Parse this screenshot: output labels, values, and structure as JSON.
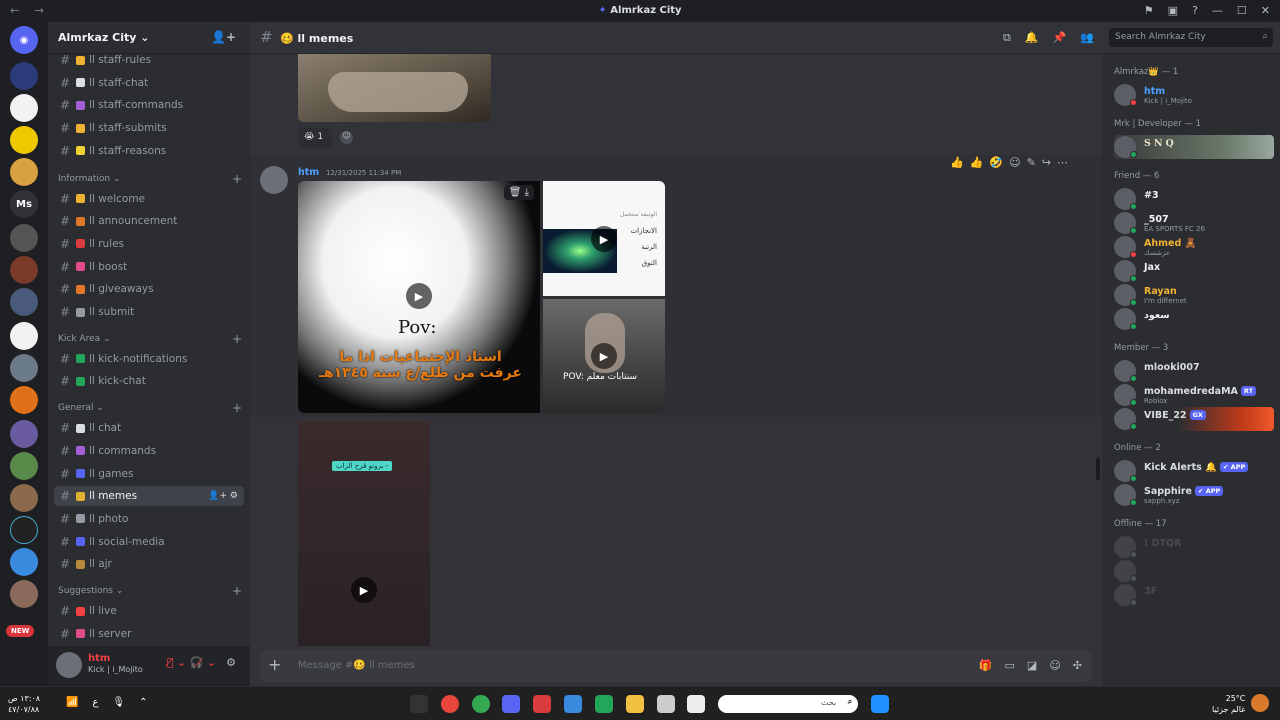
{
  "window": {
    "title": "Almrkaz City"
  },
  "server": {
    "name": "Almrkaz City"
  },
  "channels": {
    "top": [
      {
        "name": "staff-rules",
        "emoji_color": "#f0b232"
      },
      {
        "name": "staff-chat",
        "emoji_color": "#dbdee1"
      },
      {
        "name": "staff-commands",
        "emoji_color": "#a55fd6"
      },
      {
        "name": "staff-submits",
        "emoji_color": "#f0b232"
      },
      {
        "name": "staff-reasons",
        "emoji_color": "#f0d232"
      }
    ],
    "categories": [
      {
        "name": "Information",
        "items": [
          {
            "name": "welcome",
            "emoji_color": "#f0b232"
          },
          {
            "name": "announcement",
            "emoji_color": "#e0772a"
          },
          {
            "name": "rules",
            "emoji_color": "#d83c3e"
          },
          {
            "name": "boost",
            "emoji_color": "#e04c8a"
          },
          {
            "name": "giveaways",
            "emoji_color": "#e0772a"
          },
          {
            "name": "submit",
            "emoji_color": "#949ba4"
          }
        ]
      },
      {
        "name": "Kick Area",
        "items": [
          {
            "name": "kick-notifications",
            "emoji_color": "#23a55a"
          },
          {
            "name": "kick-chat",
            "emoji_color": "#23a55a"
          }
        ]
      },
      {
        "name": "General",
        "items": [
          {
            "name": "chat",
            "emoji_color": "#dbdee1"
          },
          {
            "name": "commands",
            "emoji_color": "#a55fd6"
          },
          {
            "name": "games",
            "emoji_color": "#5865f2"
          },
          {
            "name": "memes",
            "emoji_color": "#e0b232"
          },
          {
            "name": "photo",
            "emoji_color": "#949ba4"
          },
          {
            "name": "social-media",
            "emoji_color": "#5865f2"
          },
          {
            "name": "ajr",
            "emoji_color": "#b58a3a"
          }
        ]
      },
      {
        "name": "Suggestions",
        "items": [
          {
            "name": "live",
            "emoji_color": "#f23f43"
          },
          {
            "name": "server",
            "emoji_color": "#e04c8a"
          }
        ]
      }
    ]
  },
  "active_channel": "memes",
  "user": {
    "name": "htm",
    "status": "Kick | i_Mojito"
  },
  "chat_header": {
    "channel": "ll memes"
  },
  "search": {
    "placeholder": "Search Almrkaz City"
  },
  "messages": {
    "reaction_count": "1",
    "author": "htm",
    "timestamp": "12/31/2025 11:34 PM",
    "media1": {
      "pov": "Pov:",
      "caption": "استاذ الإجتماعيات اذا ما عرفت من طلع/ع سنة ١٣٤٥هـ"
    },
    "media2": {
      "lines": [
        "الانجازات",
        "الرتبة",
        "التوق"
      ],
      "header": "الوثيقة ستحمل"
    },
    "media3": {
      "caption": "POV: سنتابات معلم"
    },
    "media4": {
      "tag": "برونو قرح الراب -"
    }
  },
  "composer": {
    "placeholder": "Message #🥴 ll memes"
  },
  "members": {
    "groups": [
      {
        "label": "Almrkaz👑 — 1",
        "members": [
          {
            "name": "htm",
            "sub": "Kick | i_Mojito",
            "color": "#4ea0ff",
            "status": "#f23f43"
          }
        ]
      },
      {
        "label": "Mrk | Developer — 1",
        "members": [
          {
            "name": "SNQ",
            "sub": "",
            "color": "#e8e0c8",
            "status": "#23a55a"
          }
        ]
      },
      {
        "label": "Friend — 6",
        "members": [
          {
            "name": "#3",
            "sub": "",
            "color": "#f2f3f5",
            "status": "#23a55a"
          },
          {
            "name": "_507",
            "sub": "EA SPORTS FC 26",
            "color": "#f2f3f5",
            "status": "#23a55a"
          },
          {
            "name": "Ahmed 🧸",
            "sub": "عزشسك",
            "color": "#f0b232",
            "status": "#f23f43"
          },
          {
            "name": "Jax",
            "sub": "",
            "color": "#f2f3f5",
            "status": "#23a55a"
          },
          {
            "name": "Rayan",
            "sub": "I'm differnet",
            "color": "#f0b232",
            "status": "#23a55a"
          },
          {
            "name": "سعود",
            "sub": "",
            "color": "#f2f3f5",
            "status": "#23a55a"
          }
        ]
      },
      {
        "label": "Member — 3",
        "members": [
          {
            "name": "mlooki007",
            "sub": "",
            "color": "#dbdee1",
            "status": "#23a55a"
          },
          {
            "name": "mohamedredaMA",
            "sub": "Roblox",
            "color": "#dbdee1",
            "status": "#23a55a",
            "badge": "RT"
          },
          {
            "name": "VIBE_22",
            "sub": "",
            "color": "#dbdee1",
            "status": "#23a55a",
            "badge": "GX"
          }
        ]
      },
      {
        "label": "Online — 2",
        "members": [
          {
            "name": "Kick Alerts 🔔",
            "sub": "",
            "color": "#dbdee1",
            "status": "#23a55a",
            "badge": "✔ APP"
          },
          {
            "name": "Sapphire",
            "sub": "sapph.xyz",
            "color": "#dbdee1",
            "status": "#23a55a",
            "badge": "✔ APP"
          }
        ]
      },
      {
        "label": "Offline — 17",
        "members": [
          {
            "name": "! DTQR",
            "sub": "",
            "color": "#6d6f78",
            "status": "#80848e"
          },
          {
            "name": "",
            "sub": "",
            "color": "#6d6f78",
            "status": "#80848e"
          },
          {
            "name": "3F",
            "sub": "",
            "color": "#6d6f78",
            "status": "#80848e"
          }
        ]
      }
    ]
  },
  "taskbar": {
    "time_left": "١٣:٠٨ ص",
    "date_left": "٤٧/٠٧/٨٨",
    "search_placeholder": "بحث",
    "temp": "25°C",
    "weather_text": "غالم جزئيا"
  },
  "new_badge": "NEW"
}
